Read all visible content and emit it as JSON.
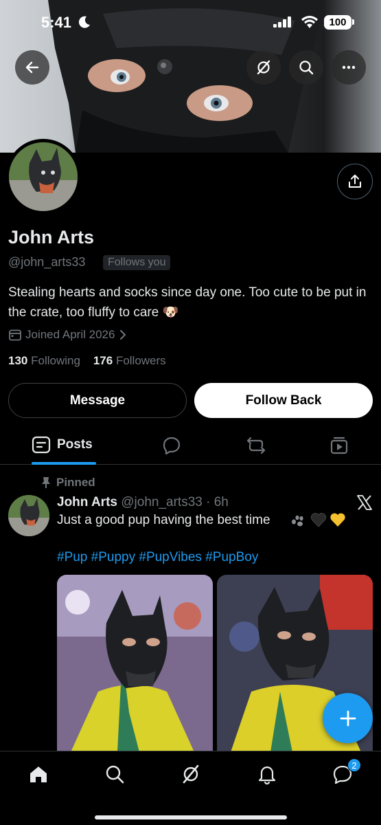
{
  "status_bar": {
    "time": "5:41",
    "battery": "100"
  },
  "profile": {
    "display_name": "John Arts",
    "handle": "@john_arts33",
    "follows_badge": "Follows you",
    "bio": "Stealing hearts and socks since day one. Too cute to be put in the crate, too fluffy to care 🐶",
    "joined": "Joined April 2026",
    "following_count": "130",
    "following_label": "Following",
    "followers_count": "176",
    "followers_label": "Followers"
  },
  "actions": {
    "message_label": "Message",
    "follow_label": "Follow Back"
  },
  "tabs": {
    "posts_label": "Posts"
  },
  "post": {
    "pinned_label": "Pinned",
    "author": "John Arts",
    "meta": "@john_arts33 · 6h",
    "text": "Just a good pup having the best time",
    "hashtags": "#Pup #Puppy #PupVibes #PupBoy"
  },
  "nav": {
    "messages_badge": "2"
  },
  "colors": {
    "accent": "#1d9bf0",
    "muted": "#71767b",
    "text": "#e7e9ea",
    "background": "#000000"
  },
  "icons": [
    "back-arrow-icon",
    "grok-icon",
    "search-icon",
    "more-icon",
    "share-icon",
    "calendar-icon",
    "chevron-right-icon",
    "posts-tab-icon",
    "replies-tab-icon",
    "reposts-tab-icon",
    "media-tab-icon",
    "pin-icon",
    "x-logo-icon",
    "plus-icon",
    "home-icon",
    "notifications-icon",
    "messages-icon"
  ]
}
